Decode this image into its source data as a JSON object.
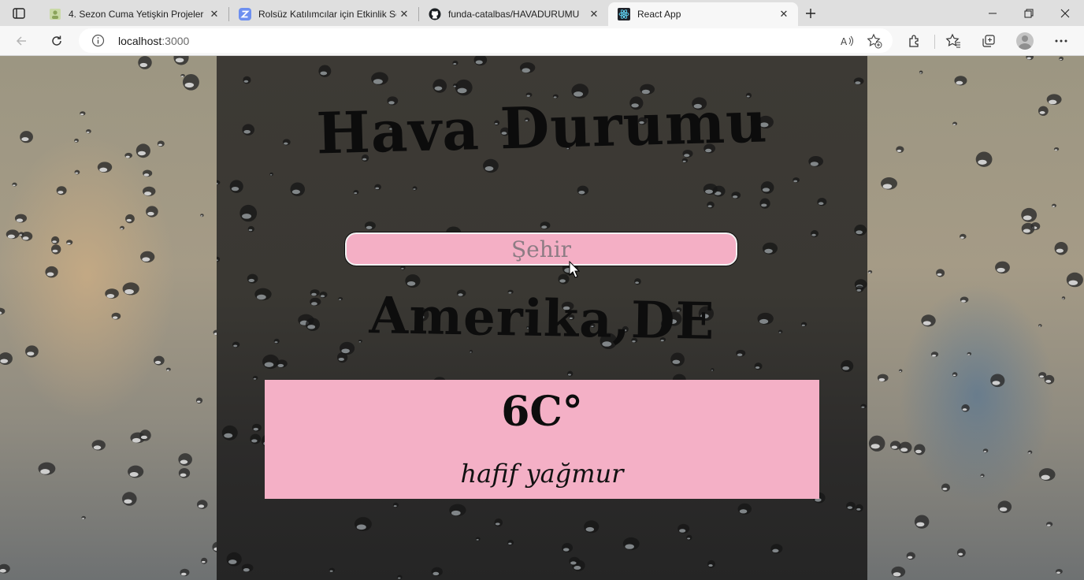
{
  "browser": {
    "tabs": [
      {
        "title": "4. Sezon Cuma Yetişkin Projeler Y",
        "favicon": "profile-icon",
        "active": false
      },
      {
        "title": "Rolsüz Katılımcılar için Etkinlik Sc",
        "favicon": "zoom-z-icon",
        "active": false
      },
      {
        "title": "funda-catalbas/HAVADURUMU",
        "favicon": "github-icon",
        "active": false
      },
      {
        "title": "React App",
        "favicon": "react-icon",
        "active": true
      }
    ],
    "address": {
      "host": "localhost",
      "port": ":3000"
    },
    "close_glyph": "✕"
  },
  "app": {
    "title": "Hava Durumu",
    "search": {
      "placeholder": "Şehir",
      "value": ""
    },
    "city": "Amerika,DE",
    "temperature": "6C°",
    "description": "hafif yağmur",
    "colors": {
      "accent_pink": "#f4b0c6",
      "panel_dark": "#3a3833"
    }
  }
}
